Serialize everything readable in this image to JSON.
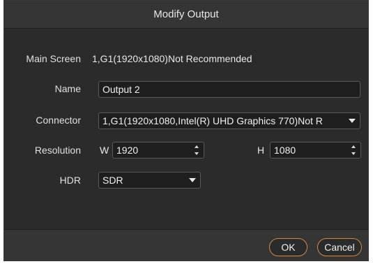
{
  "dialog": {
    "title": "Modify Output"
  },
  "main_screen": {
    "label": "Main Screen",
    "value": "1,G1(1920x1080)Not Recommended"
  },
  "name": {
    "label": "Name",
    "value": "Output 2"
  },
  "connector": {
    "label": "Connector",
    "value": "1,G1(1920x1080,Intel(R) UHD Graphics 770)Not R"
  },
  "resolution": {
    "label": "Resolution",
    "w_label": "W",
    "w_value": "1920",
    "h_label": "H",
    "h_value": "1080"
  },
  "hdr": {
    "label": "HDR",
    "value": "SDR"
  },
  "buttons": {
    "ok": "OK",
    "cancel": "Cancel"
  },
  "colors": {
    "dialog_bg": "#2b2b2b",
    "header_bg": "#353535",
    "field_bg": "#1e1e1e",
    "button_border": "#d58a3a"
  },
  "icons": {
    "dropdown": "caret-down-icon",
    "spinner": "spinner-arrows-icon"
  }
}
